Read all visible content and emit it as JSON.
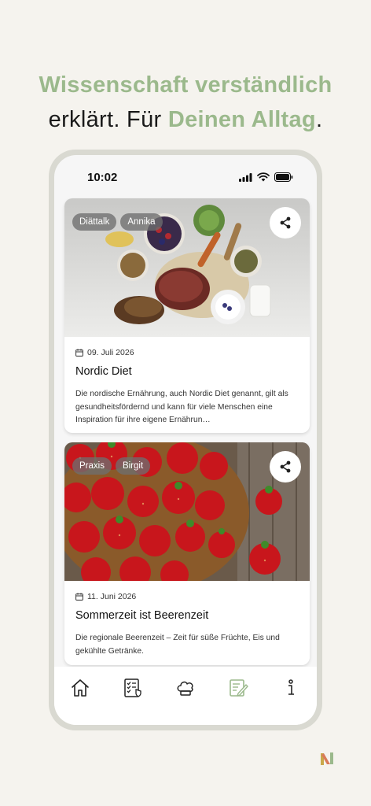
{
  "headline": {
    "line1": "Wissenschaft verständlich",
    "line2_a": "erklärt. Für ",
    "line2_b": "Deinen Alltag",
    "line2_c": "."
  },
  "statusbar": {
    "time": "10:02"
  },
  "articles": [
    {
      "tags": [
        "Diättalk",
        "Annika"
      ],
      "date": "09. Juli 2026",
      "title": "Nordic Diet",
      "excerpt": "Die nordische Ernährung, auch Nordic Diet genannt, gilt als gesundheitsfördernd und kann für viele Menschen eine Inspiration für ihre eigene Ernährun…"
    },
    {
      "tags": [
        "Praxis",
        "Birgit"
      ],
      "date": "11. Juni 2026",
      "title": "Sommerzeit ist Beerenzeit",
      "excerpt": "Die regionale Beerenzeit – Zeit für süße Früchte, Eis und gekühlte Getränke."
    }
  ],
  "nav": [
    {
      "icon": "home-icon",
      "active": false
    },
    {
      "icon": "checklist-icon",
      "active": false
    },
    {
      "icon": "chef-hat-icon",
      "active": false
    },
    {
      "icon": "notes-edit-icon",
      "active": true
    },
    {
      "icon": "info-icon",
      "active": false
    }
  ],
  "colors": {
    "accent": "#9bb98c",
    "background": "#f5f3ee"
  }
}
